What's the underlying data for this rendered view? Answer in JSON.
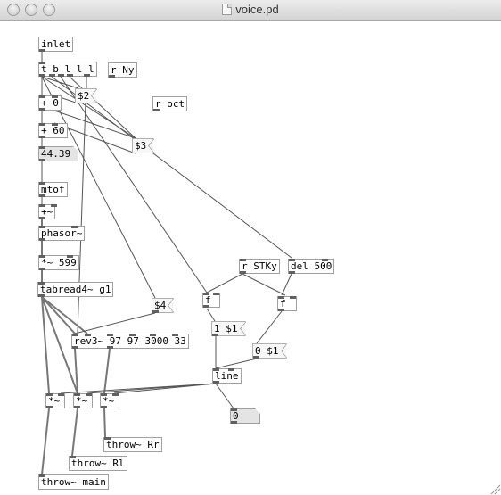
{
  "window": {
    "title": "voice.pd"
  },
  "patch": {
    "objects": {
      "inlet": "inlet",
      "trigger": "t b l l l",
      "r_ny": "r Ny",
      "r_oct": "r oct",
      "add0": "+ 0",
      "add60": "+ 60",
      "mtof": "mtof",
      "sigadd": "+~",
      "phasor": "phasor~",
      "mul599": "*~ 599",
      "tabread": "tabread4~ g1",
      "rev3": "rev3~ 97 97 3000 33",
      "r_stky": "r STKy",
      "del500": "del 500",
      "f_left": "f",
      "f_right": "f",
      "line": "line",
      "mul_a": "*~",
      "mul_b": "*~",
      "mul_c": "*~",
      "throw_rr": "throw~ Rr",
      "throw_rl": "throw~ Rl",
      "throw_main": "throw~ main"
    },
    "messages": {
      "msg_s2": "$2",
      "msg_s3": "$3",
      "msg_s4": "$4",
      "msg_1s1": "1 $1",
      "msg_0s1": "0 $1"
    },
    "atoms": {
      "num_pitch": "44.39",
      "num_line": "0"
    }
  }
}
